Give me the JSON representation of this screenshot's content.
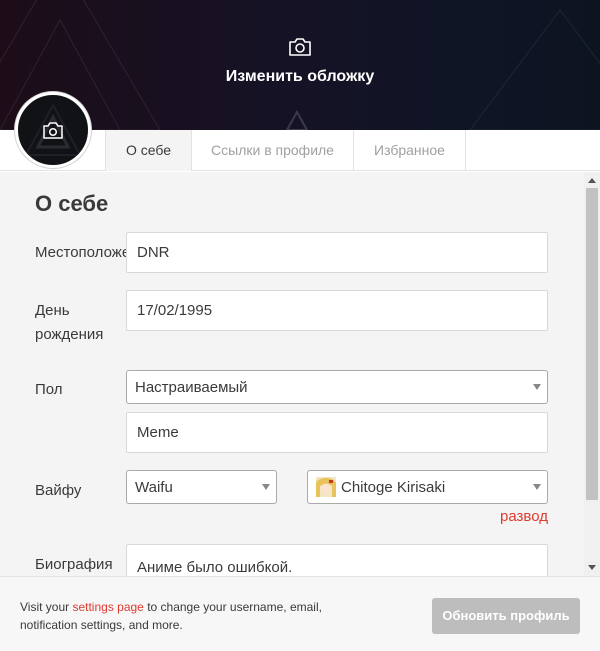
{
  "cover": {
    "change_label": "Изменить обложку",
    "camera_icon": "camera-icon"
  },
  "avatar": {
    "camera_icon": "camera-icon"
  },
  "tabs": [
    {
      "label": "О себе",
      "active": true
    },
    {
      "label": "Ссылки в профиле",
      "active": false
    },
    {
      "label": "Избранное",
      "active": false
    }
  ],
  "about": {
    "title": "О себе",
    "location": {
      "label": "Местоположение",
      "value": "DNR"
    },
    "birthday": {
      "label_line1": "День",
      "label_line2": "рождения",
      "value": "17/02/1995"
    },
    "gender": {
      "label": "Пол",
      "selected": "Настраиваемый",
      "custom_value": "Meme"
    },
    "waifu": {
      "label": "Вайфу",
      "type_selected": "Waifu",
      "character_selected": "Chitoge Kirisaki",
      "divorce_link": "развод"
    },
    "bio": {
      "label": "Биография",
      "value": "Аниме было ошибкой."
    }
  },
  "footer": {
    "text_before": "Visit your ",
    "settings_link": "settings page",
    "text_after": " to change your username, email, notification settings, and more.",
    "update_button": "Обновить профиль"
  },
  "colors": {
    "accent_red": "#e03a2f",
    "button_disabled": "#bdbdbd",
    "panel_bg": "#f4f4f4"
  }
}
